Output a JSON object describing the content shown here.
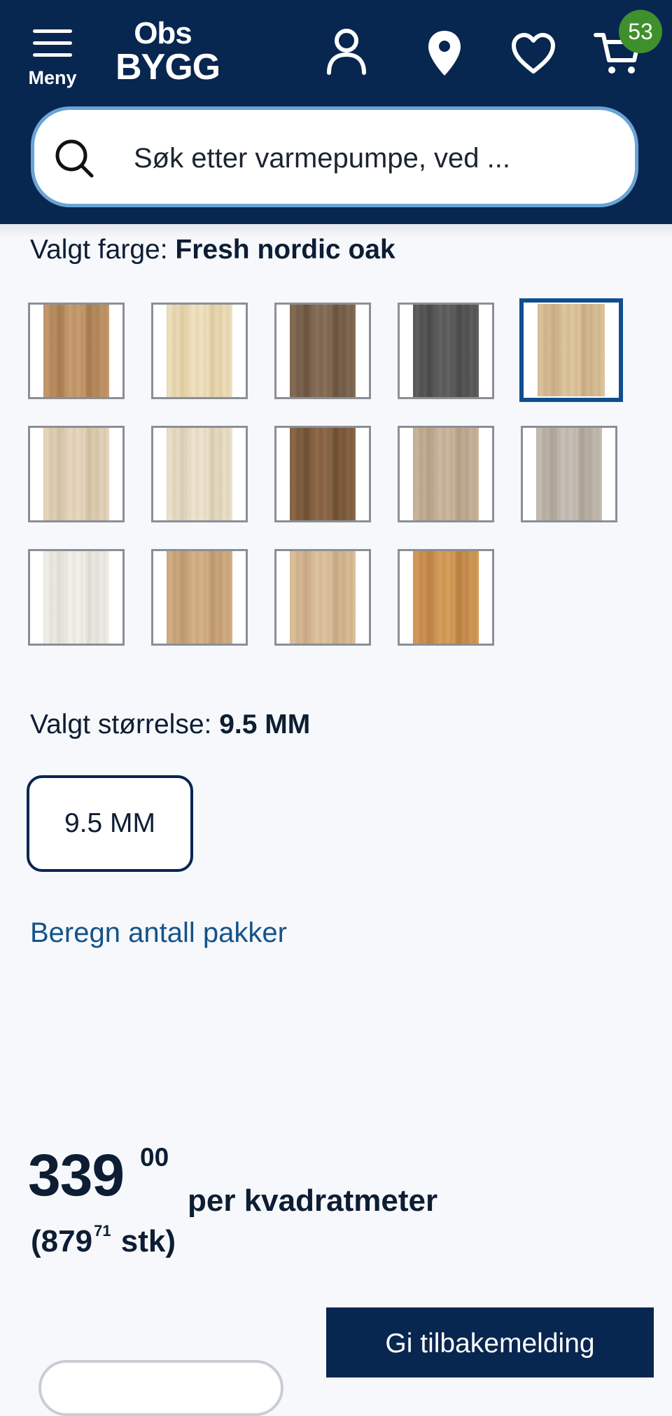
{
  "header": {
    "menu_label": "Meny",
    "logo_top": "Obs",
    "logo_bottom": "BYGG",
    "cart_count": "53",
    "search_placeholder": "Søk etter varmepumpe, ved ...",
    "brand_color": "#072650"
  },
  "color": {
    "label": "Valgt farge:",
    "selected": "Fresh nordic oak",
    "swatches": [
      {
        "colors": [
          "#c4986a",
          "#a97b4f"
        ],
        "selected": false
      },
      {
        "colors": [
          "#efe0bd",
          "#e3cfa4"
        ],
        "selected": false
      },
      {
        "colors": [
          "#836a52",
          "#6a543f"
        ],
        "selected": false
      },
      {
        "colors": [
          "#5d5c5c",
          "#4a4a4b"
        ],
        "selected": false
      },
      {
        "colors": [
          "#dcc29a",
          "#cbae85"
        ],
        "selected": true
      },
      {
        "colors": [
          "#e6d5bb",
          "#d6c3a4"
        ],
        "selected": false
      },
      {
        "colors": [
          "#ece2cc",
          "#ddd0b5"
        ],
        "selected": false
      },
      {
        "colors": [
          "#8a6544",
          "#6f4f33"
        ],
        "selected": false
      },
      {
        "colors": [
          "#c9b49b",
          "#b7a186"
        ],
        "selected": false
      },
      {
        "colors": [
          "#c5bcb2",
          "#aea497"
        ],
        "selected": false
      },
      {
        "colors": [
          "#f0efe8",
          "#e3e1d8"
        ],
        "selected": false
      },
      {
        "colors": [
          "#d3ae83",
          "#c19a6e"
        ],
        "selected": false
      },
      {
        "colors": [
          "#dcc09b",
          "#cbab84"
        ],
        "selected": false
      },
      {
        "colors": [
          "#d49a55",
          "#bd8143"
        ],
        "selected": false
      }
    ]
  },
  "size": {
    "label": "Valgt størrelse:",
    "selected": "9.5 MM",
    "option": "9.5 MM"
  },
  "calc_link": "Beregn antall pakker",
  "price": {
    "integer": "339",
    "cents": "00",
    "unit": "per kvadratmeter",
    "per_item_prefix": "(879",
    "per_item_cents": "71",
    "per_item_suffix": "stk)"
  },
  "feedback_button": "Gi tilbakemelding"
}
